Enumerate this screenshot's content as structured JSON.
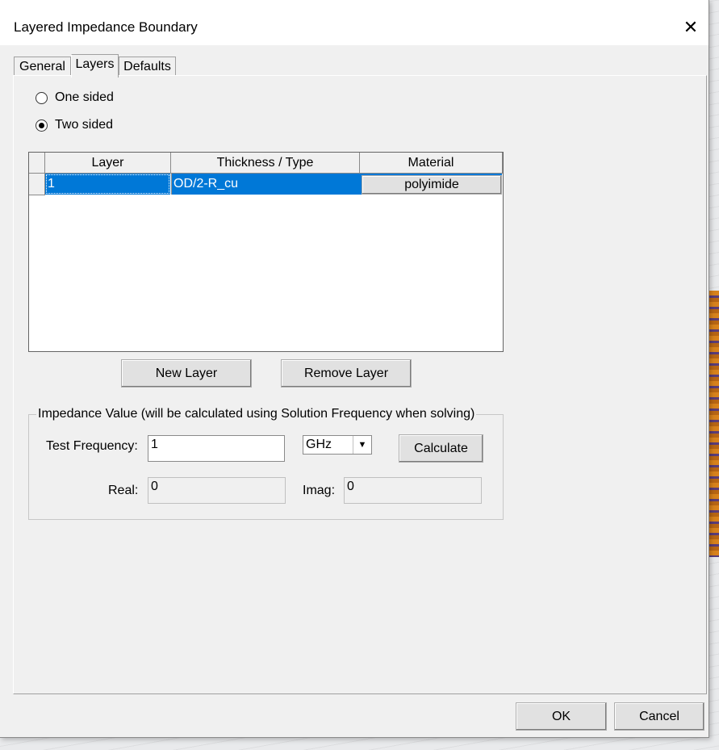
{
  "window": {
    "title": "Layered Impedance Boundary"
  },
  "tabs": [
    {
      "label": "General"
    },
    {
      "label": "Layers"
    },
    {
      "label": "Defaults"
    }
  ],
  "sidedness": {
    "options": [
      {
        "label": "One sided",
        "checked": false
      },
      {
        "label": "Two sided",
        "checked": true
      }
    ]
  },
  "layers_table": {
    "columns": [
      "Layer",
      "Thickness / Type",
      "Material"
    ],
    "rows": [
      {
        "layer": "1",
        "thickness": "OD/2-R_cu",
        "material": "polyimide"
      }
    ]
  },
  "buttons": {
    "new_layer": "New Layer",
    "remove_layer": "Remove Layer",
    "calculate": "Calculate",
    "ok": "OK",
    "cancel": "Cancel"
  },
  "impedance": {
    "group_label": "Impedance Value (will be calculated using Solution Frequency when solving)",
    "test_frequency_label": "Test Frequency:",
    "test_frequency_value": "1",
    "unit_selected": "GHz",
    "real_label": "Real:",
    "real_value": "0",
    "imag_label": "Imag:",
    "imag_value": "0"
  }
}
